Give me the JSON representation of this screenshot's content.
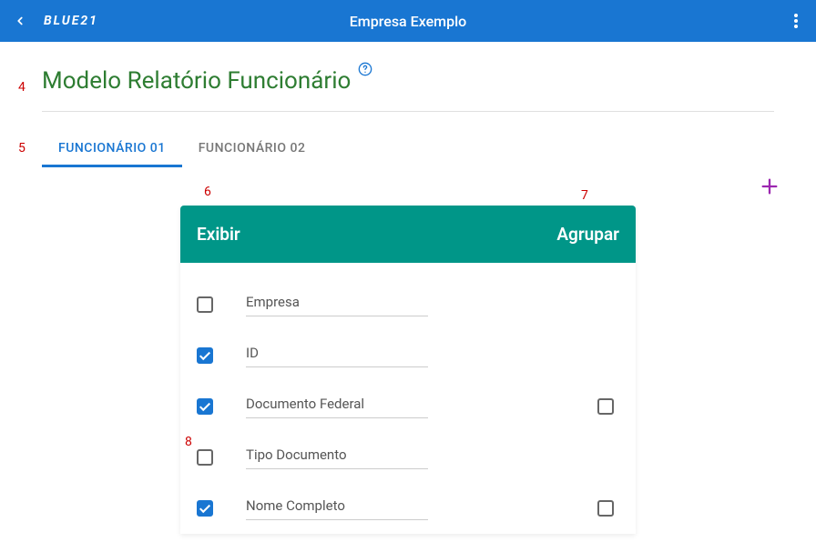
{
  "header": {
    "logo": "BLUE21",
    "title": "Empresa Exemplo"
  },
  "page": {
    "title": "Modelo Relatório Funcionário"
  },
  "tabs": [
    {
      "label": "FUNCIONÁRIO 01",
      "active": true
    },
    {
      "label": "FUNCIONÁRIO 02",
      "active": false
    }
  ],
  "panel": {
    "exibir_label": "Exibir",
    "agrupar_label": "Agrupar",
    "rows": [
      {
        "label": "Empresa",
        "exibir": false,
        "has_group": false,
        "agrupar": false
      },
      {
        "label": "ID",
        "exibir": true,
        "has_group": false,
        "agrupar": false
      },
      {
        "label": "Documento Federal",
        "exibir": true,
        "has_group": true,
        "agrupar": false
      },
      {
        "label": "Tipo Documento",
        "exibir": false,
        "has_group": false,
        "agrupar": false
      },
      {
        "label": "Nome Completo",
        "exibir": true,
        "has_group": true,
        "agrupar": false
      }
    ]
  },
  "annotations": {
    "a4": "4",
    "a5": "5",
    "a6": "6",
    "a7": "7",
    "a8": "8"
  }
}
